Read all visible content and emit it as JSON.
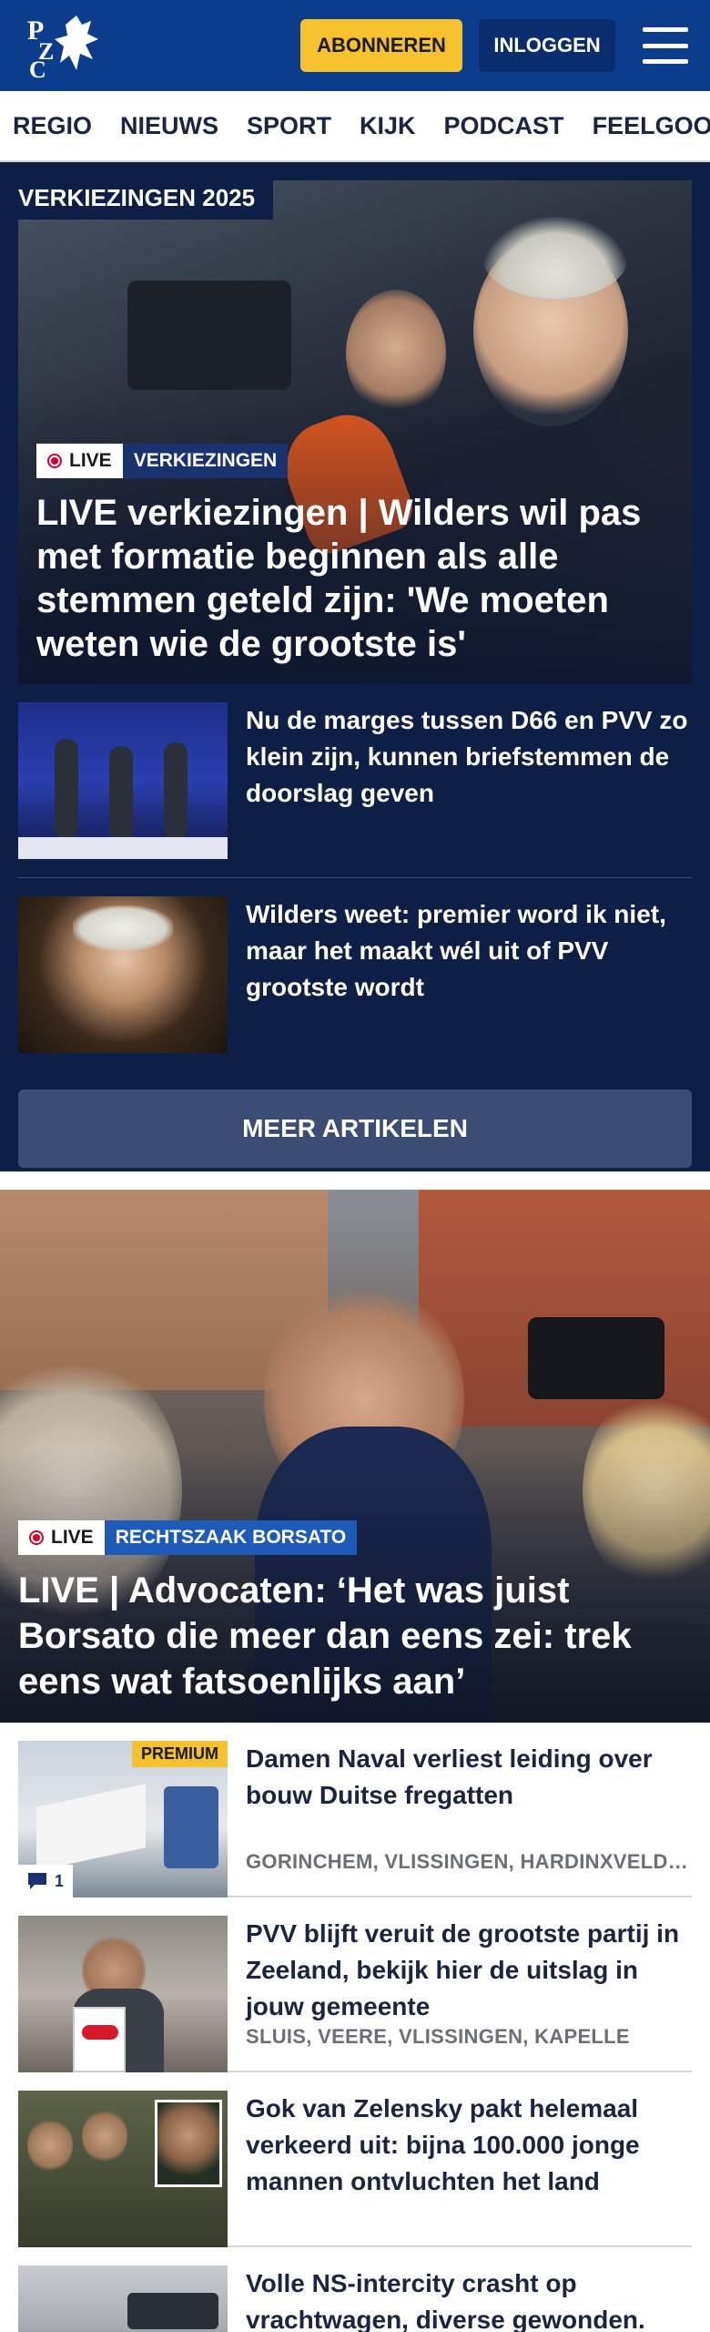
{
  "header": {
    "logo_text": "PZC",
    "subscribe_label": "ABONNEREN",
    "login_label": "INLOGGEN",
    "colors": {
      "brand": "#0c3c8c",
      "accent": "#f5c22d"
    }
  },
  "nav": {
    "items": [
      "REGIO",
      "NIEUWS",
      "SPORT",
      "KIJK",
      "PODCAST",
      "FEELGOOD"
    ]
  },
  "election_block": {
    "section_label": "VERKIEZINGEN 2025",
    "hero": {
      "live_label": "LIVE",
      "topic": "VERKIEZINGEN",
      "title": "LIVE verkiezingen | Wilders wil pas met formatie beginnen als alle stemmen geteld zijn: 'We moeten weten wie de grootste is'"
    },
    "articles": [
      {
        "title": "Nu de marges tussen D66 en PVV zo klein zijn, kunnen briefstemmen de doorslag geven"
      },
      {
        "title": "Wilders weet: premier word ik niet, maar het maakt wél uit of PVV grootste wordt"
      }
    ],
    "more_label": "MEER ARTIKELEN"
  },
  "hero2": {
    "live_label": "LIVE",
    "topic": "RECHTSZAAK BORSATO",
    "title": "LIVE | Advocaten: ‘Het was juist Borsato die meer dan eens zei: trek eens wat fatsoenlijks aan’"
  },
  "list": [
    {
      "title": "Damen Naval verliest leiding over bouw Duitse fregatten",
      "location": "GORINCHEM, VLISSINGEN, HARDINXVELD-GIESSENDAM",
      "premium": "PREMIUM",
      "comments": "1"
    },
    {
      "title": "PVV blijft veruit de grootste partij in Zeeland, bekijk hier de uitslag in jouw gemeente",
      "location": "SLUIS, VEERE, VLISSINGEN, KAPELLE"
    },
    {
      "title": "Gok van Zelensky pakt helemaal verkeerd uit: bijna 100.000 jonge mannen ontvluchten het land",
      "location": ""
    },
    {
      "title": "Volle NS-intercity crasht op vrachtwagen, diverse gewonden.",
      "location": ""
    }
  ]
}
